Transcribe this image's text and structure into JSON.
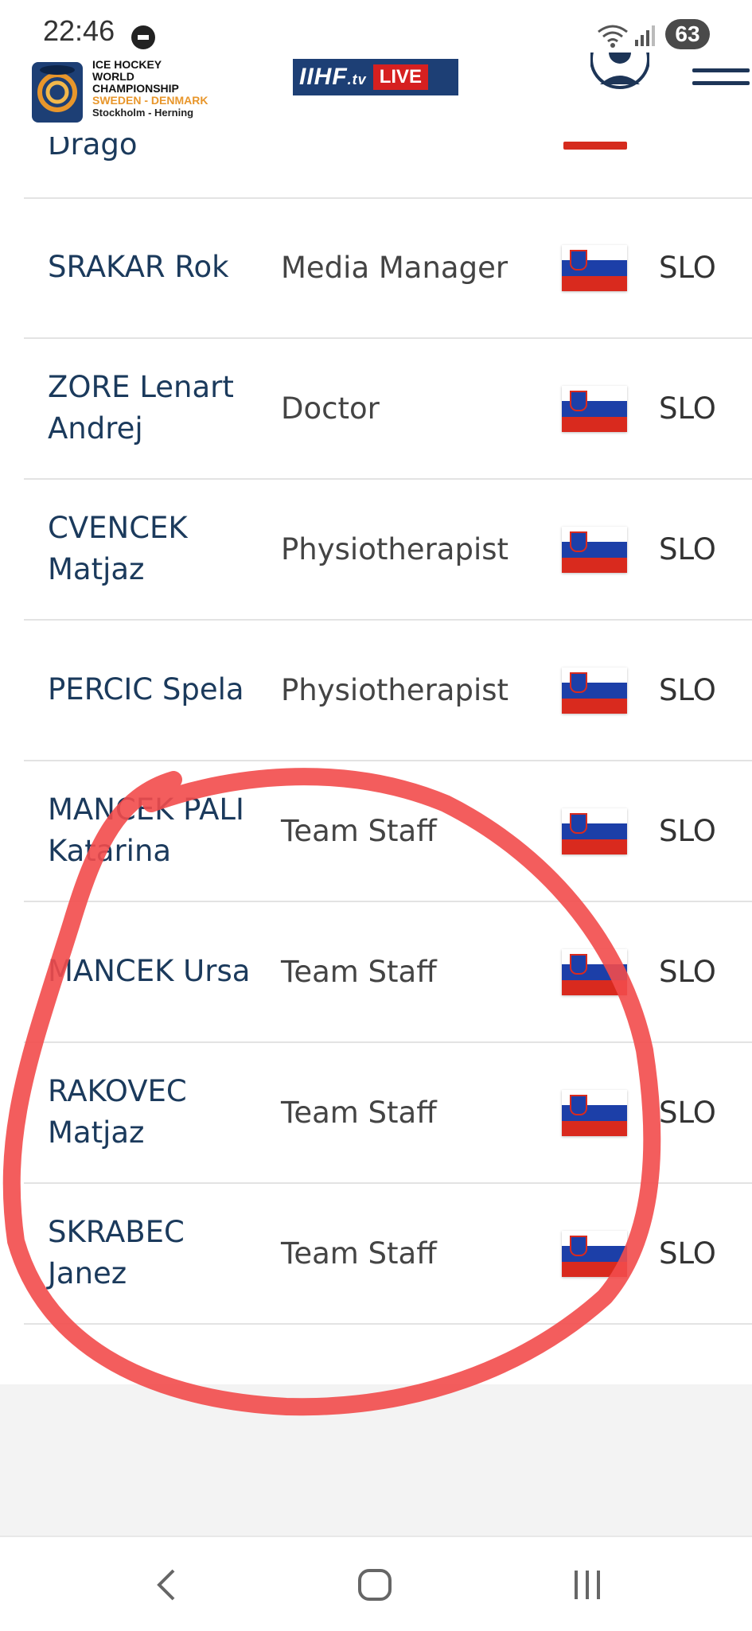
{
  "status_bar": {
    "time": "22:46",
    "battery": "63"
  },
  "header": {
    "logo_lines": [
      "ICE HOCKEY",
      "WORLD",
      "CHAMPIONSHIP",
      "SWEDEN - DENMARK",
      "Stockholm - Herning"
    ],
    "iihf_brand": "IIHF",
    "iihf_tv": ".tv",
    "live_label": "LIVE",
    "brand_color": "#1d3f75",
    "live_color": "#d62020"
  },
  "partial_row": {
    "name": "Drago"
  },
  "staff": [
    {
      "name": "SRAKAR Rok",
      "role": "Media Manager",
      "code": "SLO"
    },
    {
      "name": "ZORE Lenart Andrej",
      "role": "Doctor",
      "code": "SLO"
    },
    {
      "name": "CVENCEK Matjaz",
      "role": "Physiotherapist",
      "code": "SLO"
    },
    {
      "name": "PERCIC Spela",
      "role": "Physiotherapist",
      "code": "SLO"
    },
    {
      "name": "MANCEK PALI Katarina",
      "role": "Team Staff",
      "code": "SLO"
    },
    {
      "name": "MANCEK Ursa",
      "role": "Team Staff",
      "code": "SLO"
    },
    {
      "name": "RAKOVEC Matjaz",
      "role": "Team Staff",
      "code": "SLO"
    },
    {
      "name": "SKRABEC Janez",
      "role": "Team Staff",
      "code": "SLO"
    }
  ],
  "flag_icon": "slovenia-flag-icon",
  "annotation_color": "#f24b4b",
  "nav": {
    "back_icon": "back-icon",
    "home_icon": "home-icon",
    "recents_icon": "recents-icon"
  }
}
